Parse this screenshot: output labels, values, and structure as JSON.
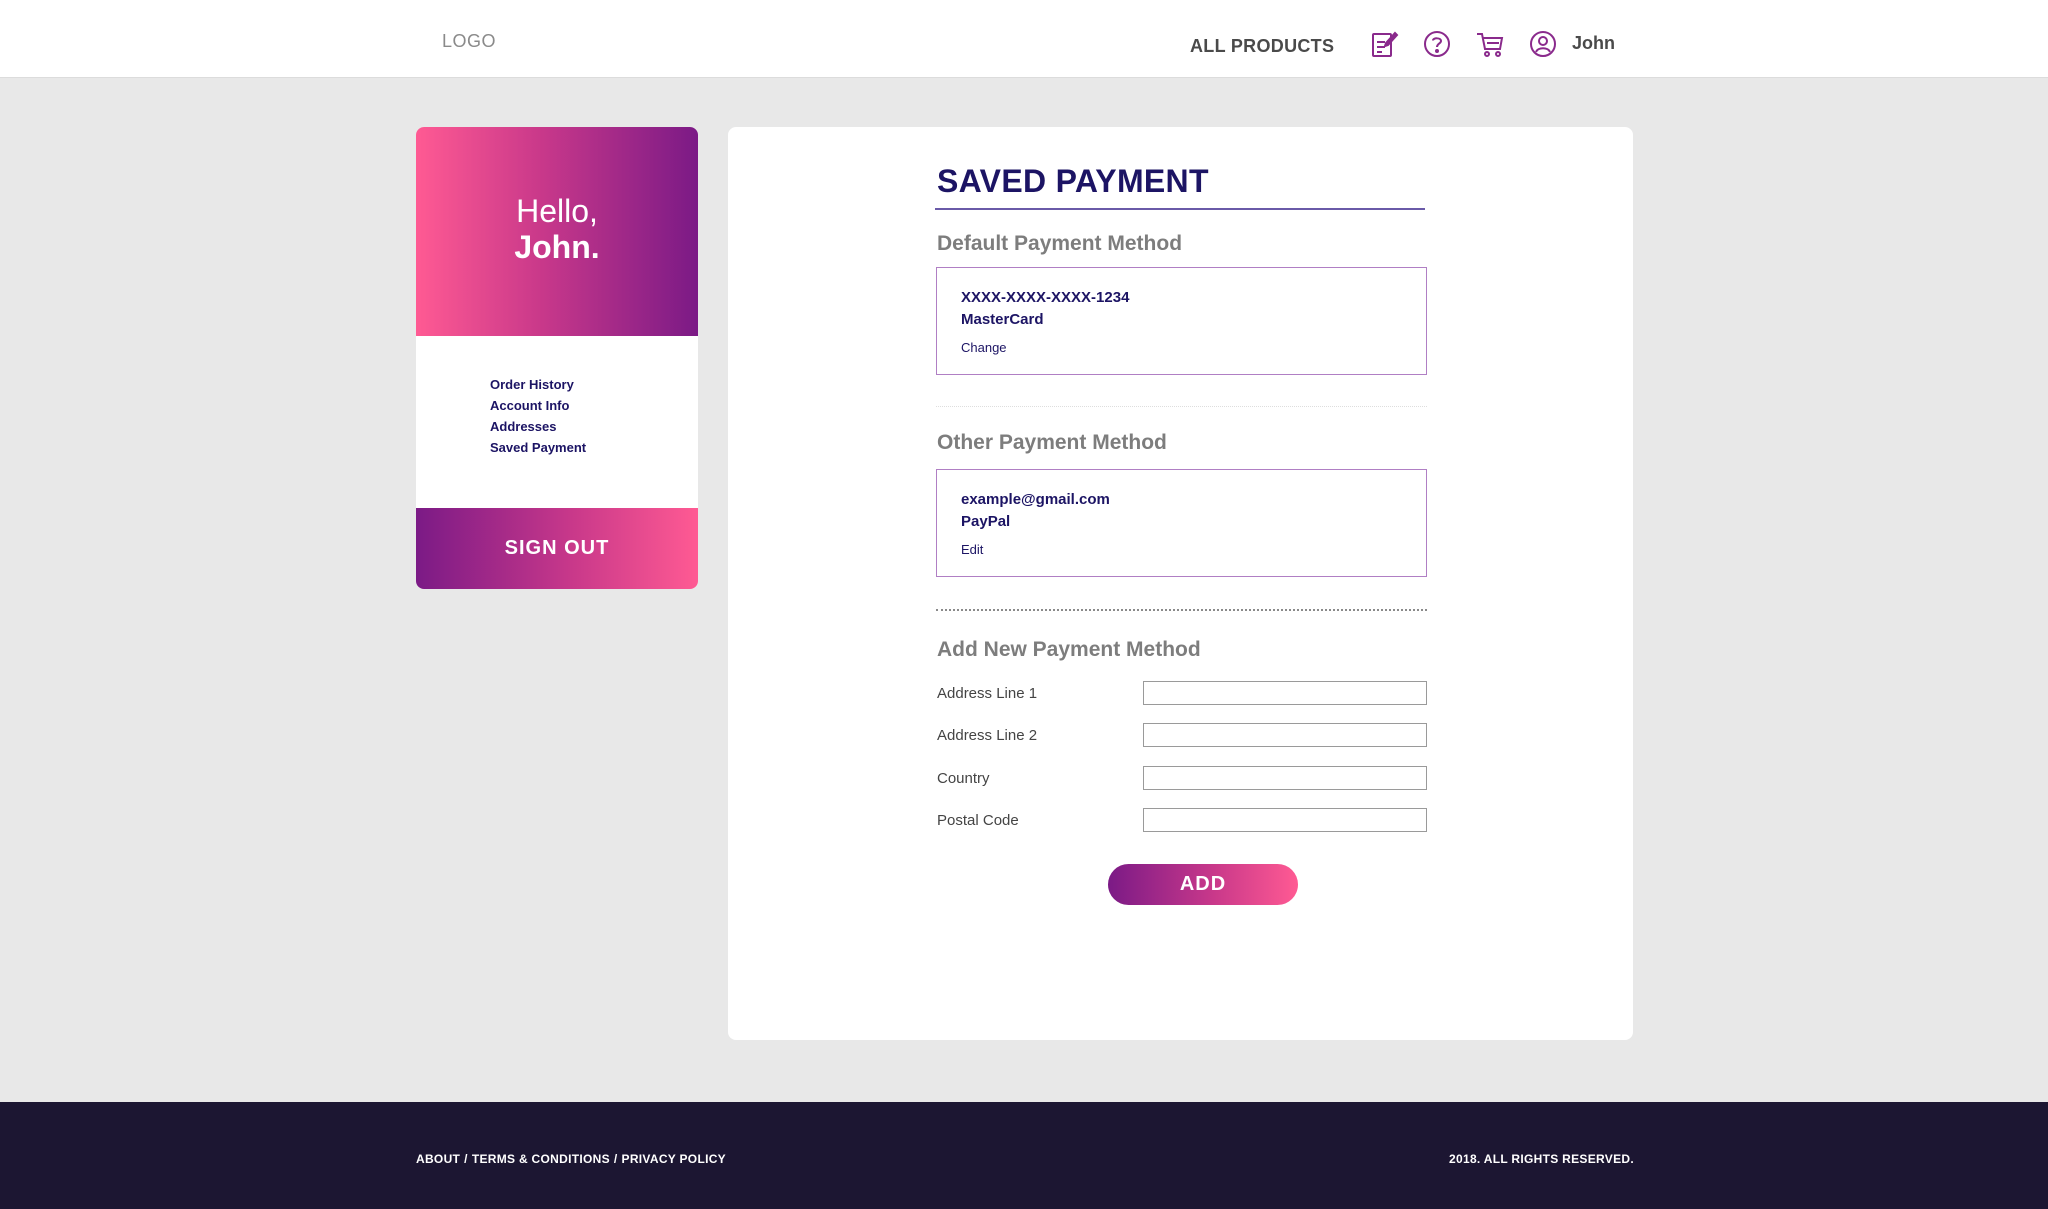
{
  "header": {
    "logo": "LOGO",
    "all_products": "ALL PRODUCTS",
    "icons": [
      "edit-note-icon",
      "help-icon",
      "cart-icon",
      "user-icon"
    ],
    "username": "John"
  },
  "sidebar": {
    "greeting": "Hello,",
    "name": "John.",
    "nav": [
      "Order History",
      "Account Info",
      "Addresses",
      "Saved Payment"
    ],
    "sign_out": "SIGN OUT"
  },
  "main": {
    "title": "SAVED PAYMENT",
    "default_section": {
      "title": "Default Payment Method",
      "line1": "XXXX-XXXX-XXXX-1234",
      "line2": "MasterCard",
      "action": "Change"
    },
    "other_section": {
      "title": "Other Payment Method",
      "line1": "example@gmail.com",
      "line2": "PayPal",
      "action": "Edit"
    },
    "new_section": {
      "title": "Add New Payment Method",
      "fields": [
        {
          "label": "Address Line 1",
          "value": ""
        },
        {
          "label": "Address Line 2",
          "value": ""
        },
        {
          "label": "Country",
          "value": ""
        },
        {
          "label": "Postal Code",
          "value": ""
        }
      ],
      "add_label": "ADD"
    }
  },
  "footer": {
    "about": "ABOUT",
    "terms": "TERMS & CONDITIONS",
    "privacy": "PRIVACY POLICY",
    "copyright": "2018. ALL RIGHTS RESERVED."
  },
  "colors": {
    "brand_navy": "#1c1464",
    "gradient_pink": "#ff5a93",
    "gradient_purple": "#7b1a86",
    "footer_bg": "#1c1632",
    "page_bg": "#e8e8e8"
  }
}
